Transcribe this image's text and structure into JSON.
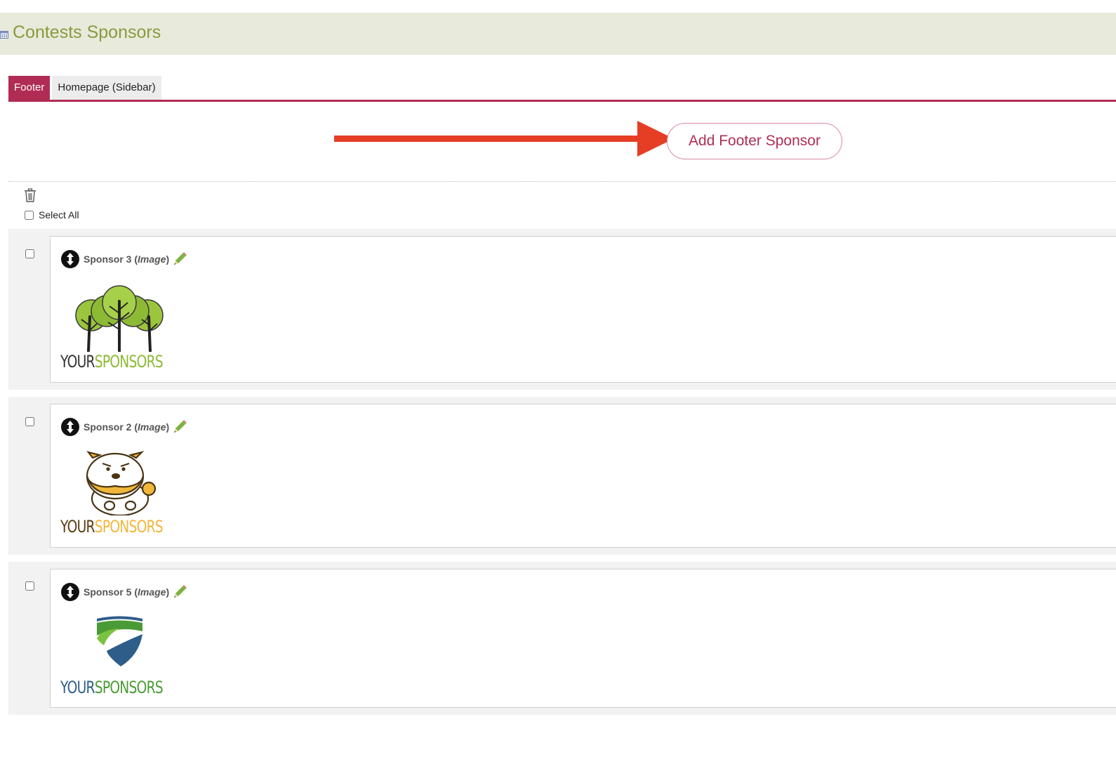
{
  "page": {
    "title": "Contests Sponsors"
  },
  "tabs": [
    {
      "label": "Footer",
      "active": true
    },
    {
      "label": "Homepage (Sidebar)",
      "active": false
    }
  ],
  "actions": {
    "add_label": "Add Footer Sponsor"
  },
  "list": {
    "select_all_label": "Select All"
  },
  "colors": {
    "accent": "#b12c55",
    "title": "#8a9a3c",
    "header_bg": "#e8eadc",
    "arrow": "#e63e24"
  },
  "sponsors": [
    {
      "name": "Sponsor 3",
      "type": "Image",
      "logo": {
        "part1": "YOUR",
        "part2": "SPONSORS",
        "icon": "trees-icon",
        "color1": "#333333",
        "color2": "#8cba34"
      }
    },
    {
      "name": "Sponsor 2",
      "type": "Image",
      "logo": {
        "part1": "YOUR",
        "part2": "SPONSORS",
        "icon": "bulldog-icon",
        "color1": "#5a3b12",
        "color2": "#f0b73a"
      }
    },
    {
      "name": "Sponsor 5",
      "type": "Image",
      "logo": {
        "part1": "YOUR",
        "part2": "SPONSORS",
        "icon": "shield-icon",
        "color1": "#2e5d8a",
        "color2": "#4a9b35"
      }
    }
  ]
}
